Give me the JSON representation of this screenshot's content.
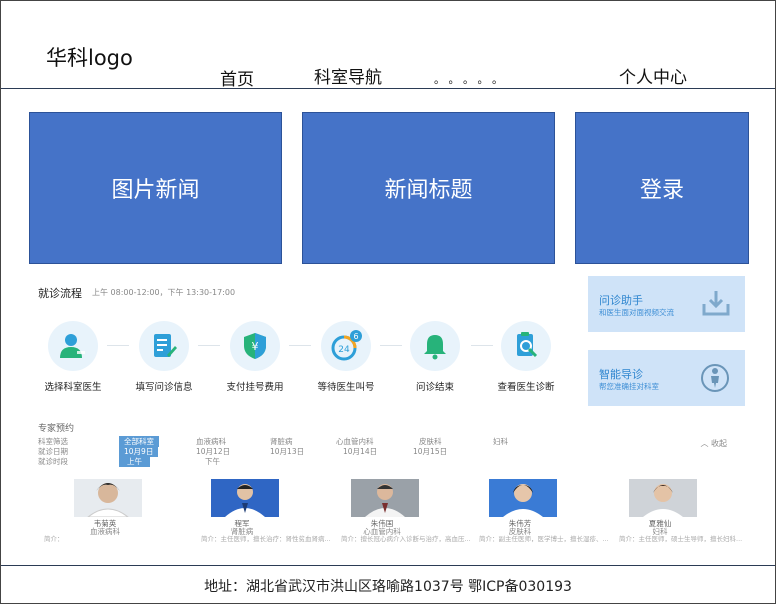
{
  "header": {
    "logo": "华科logo",
    "nav": [
      "首页",
      "科室导航",
      "个人中心"
    ],
    "ellipsis": "。。。。。"
  },
  "tiles": [
    "图片新闻",
    "新闻标题",
    "登录"
  ],
  "process": {
    "title": "就诊流程",
    "hours": "上午 08:00-12:00，下午 13:30-17:00",
    "steps": [
      {
        "label": "选择科室医生",
        "icon": "doctor-icon"
      },
      {
        "label": "填写问诊信息",
        "icon": "form-edit-icon"
      },
      {
        "label": "支付挂号费用",
        "icon": "yuan-shield-icon"
      },
      {
        "label": "等待医生叫号",
        "icon": "queue-24-icon",
        "badge": "6",
        "num": "24"
      },
      {
        "label": "问诊结束",
        "icon": "bell-icon"
      },
      {
        "label": "查看医生诊断",
        "icon": "diagnosis-search-icon"
      }
    ]
  },
  "side_cards": [
    {
      "title": "问诊助手",
      "subtitle": "和医生面对面视频交流",
      "icon": "download-icon"
    },
    {
      "title": "智能导诊",
      "subtitle": "帮您准确挂对科室",
      "icon": "person-guide-icon"
    }
  ],
  "schedule": {
    "title": "专家预约",
    "collapse": "收起",
    "filter_dept_label": "科室筛选",
    "depts": [
      "全部科室",
      "血液病科",
      "肾脏病",
      "心血管内科",
      "皮肤科",
      "妇科"
    ],
    "filter_date_label": "就诊日期",
    "dates": [
      "10月9日",
      "10月12日",
      "10月13日",
      "10月14日",
      "10月15日"
    ],
    "filter_time_label": "就诊时段",
    "times": [
      "上午",
      "下午"
    ],
    "doctors": [
      {
        "name": "韦菊英",
        "dept": "血液病科",
        "intro": "简介："
      },
      {
        "name": "程军",
        "dept": "肾脏病",
        "intro": "简介：主任医师，擅长治疗：肾性贫血肾病..."
      },
      {
        "name": "朱伟国",
        "dept": "心血管内科",
        "intro": "简介：擅长冠心病介入诊断与治疗，高血压..."
      },
      {
        "name": "朱伟芳",
        "dept": "皮肤科",
        "intro": "简介：副主任医师，医学博士，擅长湿疹、..."
      },
      {
        "name": "夏雅仙",
        "dept": "妇科",
        "intro": "简介：主任医师，硕士生导师，擅长妇科..."
      }
    ]
  },
  "footer": "地址：湖北省武汉市洪山区珞喻路1037号 鄂ICP备030193",
  "colors": {
    "tile": "#4573c8",
    "side_card": "#cfe3f8",
    "accent": "#2f86cf"
  }
}
